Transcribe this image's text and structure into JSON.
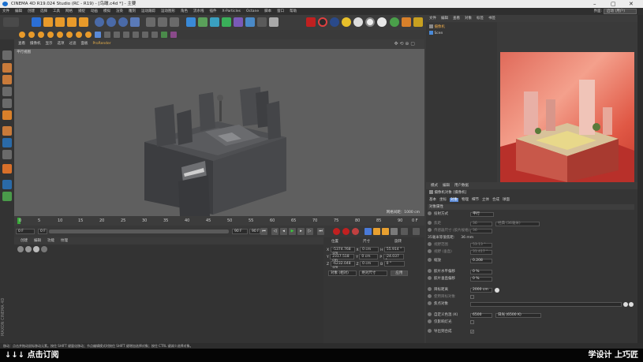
{
  "window": {
    "title": "CINEMA 4D R19.024 Studio (RC - R19) - [鸟瞰.c4d *] - 主要"
  },
  "menubar": {
    "items": [
      "文件",
      "编辑",
      "创建",
      "选择",
      "工具",
      "网格",
      "捕捉",
      "动画",
      "模拟",
      "渲染",
      "雕刻",
      "运动跟踪",
      "运动图形",
      "角色",
      "流水线",
      "插件",
      "X-Particles",
      "Octane",
      "脚本",
      "窗口",
      "帮助"
    ],
    "interface_label": "界面:",
    "interface_value": "启动 (用户)"
  },
  "viewport": {
    "menu": [
      "查看",
      "摄像机",
      "显示",
      "选项",
      "过滤",
      "面板",
      "ProRender"
    ],
    "label": "平行视图",
    "grid_spacing": "网格间距：1000 cm"
  },
  "timeline": {
    "ticks": [
      "0",
      "5",
      "10",
      "15",
      "20",
      "25",
      "30",
      "35",
      "40",
      "45",
      "50",
      "55",
      "60",
      "65",
      "70",
      "75",
      "80",
      "85",
      "90"
    ],
    "end_label": "0 F",
    "current_frame": "0 F",
    "start_frame": "0 F",
    "end_frame": "90 F",
    "max_frame": "90 F"
  },
  "materials": {
    "tabs": [
      "创建",
      "编辑",
      "功能",
      "纹理"
    ]
  },
  "coords": {
    "headers": [
      "位置",
      "尺寸",
      "旋转"
    ],
    "rows": [
      {
        "axis": "X",
        "pos": "-5374.768 cm",
        "size": "0 cm",
        "rot_axis": "H",
        "rot": "55.914 °"
      },
      {
        "axis": "Y",
        "pos": "2317.518 cm",
        "size": "0 cm",
        "rot_axis": "P",
        "rot": "-24.037 °"
      },
      {
        "axis": "Z",
        "pos": "-6232.048 cm",
        "size": "0 cm",
        "rot_axis": "B",
        "rot": "0 °"
      }
    ],
    "mode_a": "对象 (相对)",
    "mode_b": "绝对尺寸",
    "apply": "应用"
  },
  "objects": {
    "menu": [
      "文件",
      "编辑",
      "查看",
      "对象",
      "标签",
      "书签"
    ],
    "items": [
      {
        "name": "摄像机"
      },
      {
        "name": "Scen"
      }
    ]
  },
  "attributes": {
    "menu": [
      "模式",
      "编辑",
      "用户数据"
    ],
    "object_title": "摄像机对象 [摄像机]",
    "tabs": [
      "基本",
      "坐标",
      "对象",
      "物理",
      "细节",
      "立体",
      "合成",
      "球面"
    ],
    "section": "对象属性",
    "rows": [
      {
        "label": "投射方式",
        "value": "平行"
      },
      {
        "label": "焦距",
        "value": "36"
      },
      {
        "label": "传感器尺寸 (胶片规格)",
        "value": "36"
      },
      {
        "label": "35毫米等值焦距:",
        "value": "36 mm"
      },
      {
        "label": "视野范围",
        "value": "53.13 °"
      },
      {
        "label": "视野 (垂直)",
        "value": "31.417 °"
      },
      {
        "label": "缩放",
        "value": "0.208"
      },
      {
        "label": "胶片水平偏移",
        "value": "0 %"
      },
      {
        "label": "胶片垂直偏移",
        "value": "0 %"
      },
      {
        "label": "目标距离",
        "value": "2000 cm"
      },
      {
        "label": "使用目标对象",
        "value": ""
      },
      {
        "label": "焦点对象",
        "value": ""
      },
      {
        "label": "自定义色温 (K)",
        "value": "6500"
      },
      {
        "label": "仅影响灯光",
        "value": ""
      },
      {
        "label": "导出到合成",
        "value": ""
      }
    ],
    "focal_preset": "经典 (36毫米)",
    "temp_preset": "日光 (6500 K)"
  },
  "statusbar": {
    "text": "移动：点击并拖动鼠标移动元素。按住 SHIFT 键量化移动；节点编辑模式时按住 SHIFT 键增加选择对象；按住 CTRL 键减少选择对象。"
  },
  "bottom": {
    "left": "↓↓↓ 点击订阅",
    "right": "学设计  上巧匠"
  },
  "branding": {
    "side": "MAXON CINEMA 4D"
  }
}
